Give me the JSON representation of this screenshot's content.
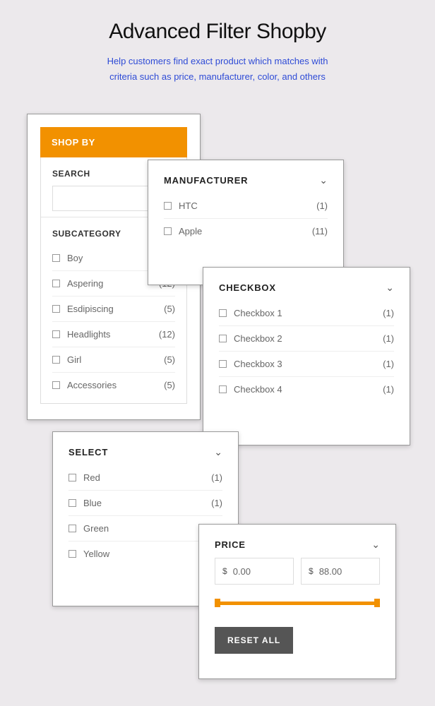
{
  "title": "Advanced Filter Shopby",
  "subtitle_l1": "Help customers find exact product which matches with",
  "subtitle_l2": "criteria such as price, manufacturer, color, and others",
  "shopby": {
    "header": "SHOP BY",
    "search_label": "SEARCH",
    "subcategory_label": "SUBCATEGORY",
    "subcats": [
      {
        "label": "Boy",
        "count": ""
      },
      {
        "label": "Aspering",
        "count": "(12)"
      },
      {
        "label": "Esdipiscing",
        "count": "(5)"
      },
      {
        "label": "Headlights",
        "count": "(12)"
      },
      {
        "label": "Girl",
        "count": "(5)"
      },
      {
        "label": "Accessories",
        "count": "(5)"
      }
    ]
  },
  "manufacturer": {
    "title": "MANUFACTURER",
    "items": [
      {
        "label": "HTC",
        "count": "(1)"
      },
      {
        "label": "Apple",
        "count": "(11)"
      }
    ]
  },
  "checkbox": {
    "title": "CHECKBOX",
    "items": [
      {
        "label": "Checkbox 1",
        "count": "(1)"
      },
      {
        "label": "Checkbox 2",
        "count": "(1)"
      },
      {
        "label": "Checkbox 3",
        "count": "(1)"
      },
      {
        "label": "Checkbox 4",
        "count": "(1)"
      }
    ]
  },
  "select": {
    "title": "SELECT",
    "items": [
      {
        "label": "Red",
        "count": "(1)"
      },
      {
        "label": "Blue",
        "count": "(1)"
      },
      {
        "label": "Green",
        "count": ""
      },
      {
        "label": "Yellow",
        "count": ""
      }
    ]
  },
  "price": {
    "title": "PRICE",
    "currency": "$",
    "from": "0.00",
    "to": "88.00",
    "reset": "RESET ALL"
  }
}
